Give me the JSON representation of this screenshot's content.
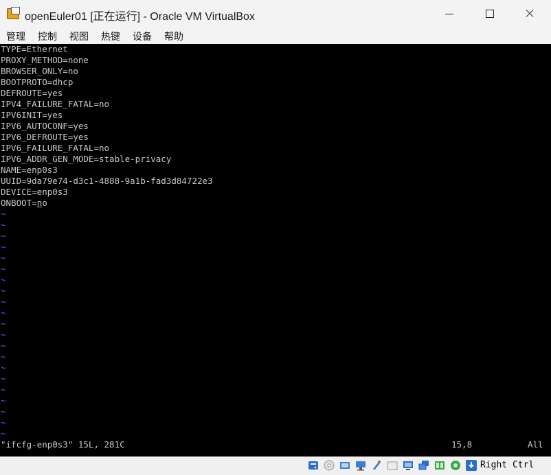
{
  "window": {
    "title": "openEuler01 [正在运行] - Oracle VM VirtualBox"
  },
  "menu": [
    {
      "label": "管理"
    },
    {
      "label": "控制"
    },
    {
      "label": "视图"
    },
    {
      "label": "热键"
    },
    {
      "label": "设备"
    },
    {
      "label": "帮助"
    }
  ],
  "terminal": {
    "lines": [
      "TYPE=Ethernet",
      "PROXY_METHOD=none",
      "BROWSER_ONLY=no",
      "BOOTPROTO=dhcp",
      "DEFROUTE=yes",
      "IPV4_FAILURE_FATAL=no",
      "IPV6INIT=yes",
      "IPV6_AUTOCONF=yes",
      "IPV6_DEFROUTE=yes",
      "IPV6_FAILURE_FATAL=no",
      "IPV6_ADDR_GEN_MODE=stable-privacy",
      "NAME=enp0s3",
      "UUID=9da79e74-d3c1-4888-9a1b-fad3d84722e3",
      "DEVICE=enp0s3"
    ],
    "last_line_prefix": "ONBOOT=",
    "last_line_cursor_char": "n",
    "last_line_suffix": "o",
    "tilde": "~",
    "status_file": "\"ifcfg-enp0s3\" 15L, 281C",
    "status_position": "15,8",
    "status_scroll": "All"
  },
  "statusbar": {
    "icons": [
      "hard-disk-icon",
      "optical-drive-icon",
      "audio-icon",
      "network-icon",
      "usb-icon",
      "shared-folders-icon",
      "display-icon",
      "video-capture-icon",
      "recording-icon",
      "mouse-integration-icon",
      "keyboard-capture-icon"
    ],
    "host_key": "Right Ctrl"
  },
  "colors": {
    "terminal_bg": "#000000",
    "terminal_text": "#c8c8c8",
    "tilde": "#5f5fff",
    "chrome": "#f3f3f3"
  }
}
